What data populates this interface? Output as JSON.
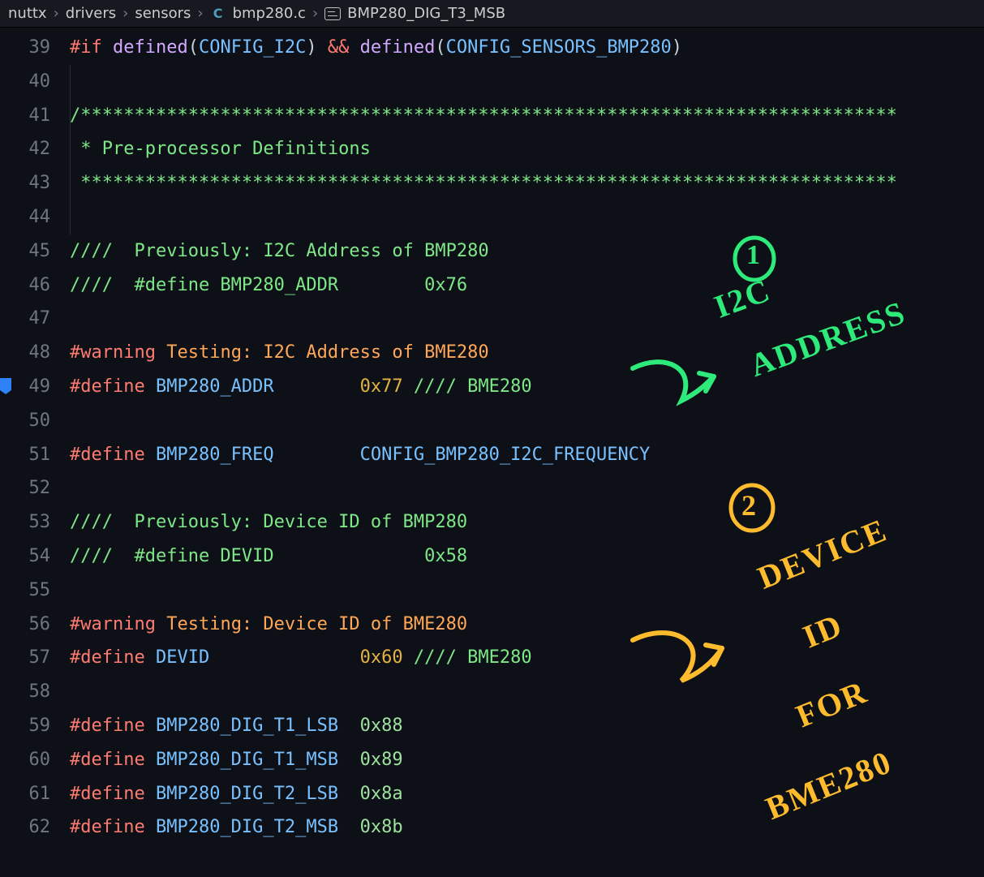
{
  "breadcrumb": {
    "seg1": "nuttx",
    "seg2": "drivers",
    "seg3": "sensors",
    "file": "bmp280.c",
    "file_icon_letter": "C",
    "symbol": "BMP280_DIG_T3_MSB"
  },
  "lines": {
    "39": {
      "num": "39"
    },
    "40": {
      "num": "40"
    },
    "41": {
      "num": "41"
    },
    "42": {
      "num": "42"
    },
    "43": {
      "num": "43"
    },
    "44": {
      "num": "44"
    },
    "45": {
      "num": "45"
    },
    "46": {
      "num": "46"
    },
    "47": {
      "num": "47"
    },
    "48": {
      "num": "48"
    },
    "49": {
      "num": "49"
    },
    "50": {
      "num": "50"
    },
    "51": {
      "num": "51"
    },
    "52": {
      "num": "52"
    },
    "53": {
      "num": "53"
    },
    "54": {
      "num": "54"
    },
    "55": {
      "num": "55"
    },
    "56": {
      "num": "56"
    },
    "57": {
      "num": "57"
    },
    "58": {
      "num": "58"
    },
    "59": {
      "num": "59"
    },
    "60": {
      "num": "60"
    },
    "61": {
      "num": "61"
    },
    "62": {
      "num": "62"
    }
  },
  "code": {
    "l39_if": "#if",
    "l39_def": "defined",
    "l39_cfg1": "CONFIG_I2C",
    "l39_amp": "&&",
    "l39_cfg2": "CONFIG_SENSORS_BMP280",
    "l41_stars": "/****************************************************************************",
    "l42_body": " * Pre-processor Definitions",
    "l43_stars": " ****************************************************************************",
    "l45": "////  Previously: I2C Address of BMP280",
    "l46": "////  #define BMP280_ADDR        0x76",
    "l48_warn": "#warning",
    "l48_txt": "Testing: I2C Address of BME280",
    "l49_def": "#define",
    "l49_name": "BMP280_ADDR",
    "l49_pad": "        ",
    "l49_val": "0x77",
    "l49_tail": " //// BME280",
    "l51_def": "#define",
    "l51_name": "BMP280_FREQ",
    "l51_pad": "        ",
    "l51_val": "CONFIG_BMP280_I2C_FREQUENCY",
    "l53": "////  Previously: Device ID of BMP280",
    "l54": "////  #define DEVID              0x58",
    "l56_warn": "#warning",
    "l56_txt": "Testing: Device ID of BME280",
    "l57_def": "#define",
    "l57_name": "DEVID",
    "l57_pad": "              ",
    "l57_val": "0x60",
    "l57_tail": " //// BME280",
    "l59_def": "#define",
    "l59_name": "BMP280_DIG_T1_LSB",
    "l59_pad": "  ",
    "l59_val": "0x88",
    "l60_def": "#define",
    "l60_name": "BMP280_DIG_T1_MSB",
    "l60_pad": "  ",
    "l60_val": "0x89",
    "l61_def": "#define",
    "l61_name": "BMP280_DIG_T2_LSB",
    "l61_pad": "  ",
    "l61_val": "0x8a",
    "l62_def": "#define",
    "l62_name": "BMP280_DIG_T2_MSB",
    "l62_pad": "  ",
    "l62_val": "0x8b"
  },
  "annotations": {
    "one_circle": "1",
    "one_line1": "I2C",
    "one_line2": "ADDRESS",
    "two_circle": "2",
    "two_line1": "DEVICE",
    "two_line2": "ID",
    "two_line3": "FOR",
    "two_line4": "BME280"
  }
}
